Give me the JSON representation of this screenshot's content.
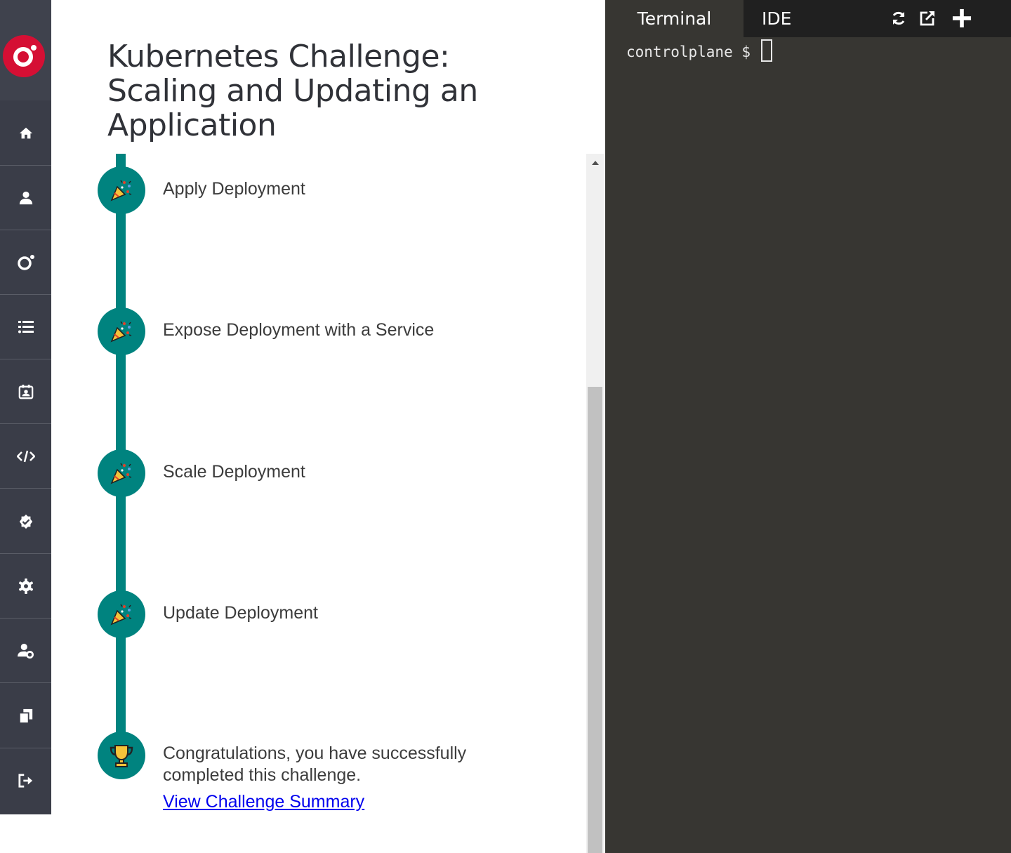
{
  "challenge": {
    "title": "Kubernetes Challenge: Scaling and Updating an Application"
  },
  "sidebar": {
    "items": [
      {
        "icon": "home-icon"
      },
      {
        "icon": "user-icon"
      },
      {
        "icon": "logo-ring-icon"
      },
      {
        "icon": "list-icon"
      },
      {
        "icon": "calendar-user-icon"
      },
      {
        "icon": "code-icon"
      },
      {
        "icon": "badge-check-icon"
      },
      {
        "icon": "gear-icon"
      },
      {
        "icon": "user-gear-icon"
      },
      {
        "icon": "documents-icon"
      },
      {
        "icon": "sign-out-icon"
      }
    ]
  },
  "steps": [
    {
      "label": "Apply Deployment",
      "icon": "party-popper-icon"
    },
    {
      "label": "Expose Deployment with a Service",
      "icon": "party-popper-icon"
    },
    {
      "label": "Scale Deployment",
      "icon": "party-popper-icon"
    },
    {
      "label": "Update Deployment",
      "icon": "party-popper-icon"
    }
  ],
  "final": {
    "icon": "trophy-icon",
    "message": "Congratulations, you have successfully completed this challenge.",
    "link": "View Challenge Summary"
  },
  "terminal": {
    "tabs": [
      {
        "label": "Terminal",
        "active": true
      },
      {
        "label": "IDE",
        "active": false
      }
    ],
    "tools": [
      "refresh-icon",
      "external-link-icon",
      "plus-icon"
    ],
    "prompt": "controlplane $ "
  },
  "colors": {
    "sidebar": "#3a3d48",
    "brand": "#d50f34",
    "timeline": "#00837f",
    "terminal_bg": "#373632",
    "tabbar_bg": "#202020"
  }
}
